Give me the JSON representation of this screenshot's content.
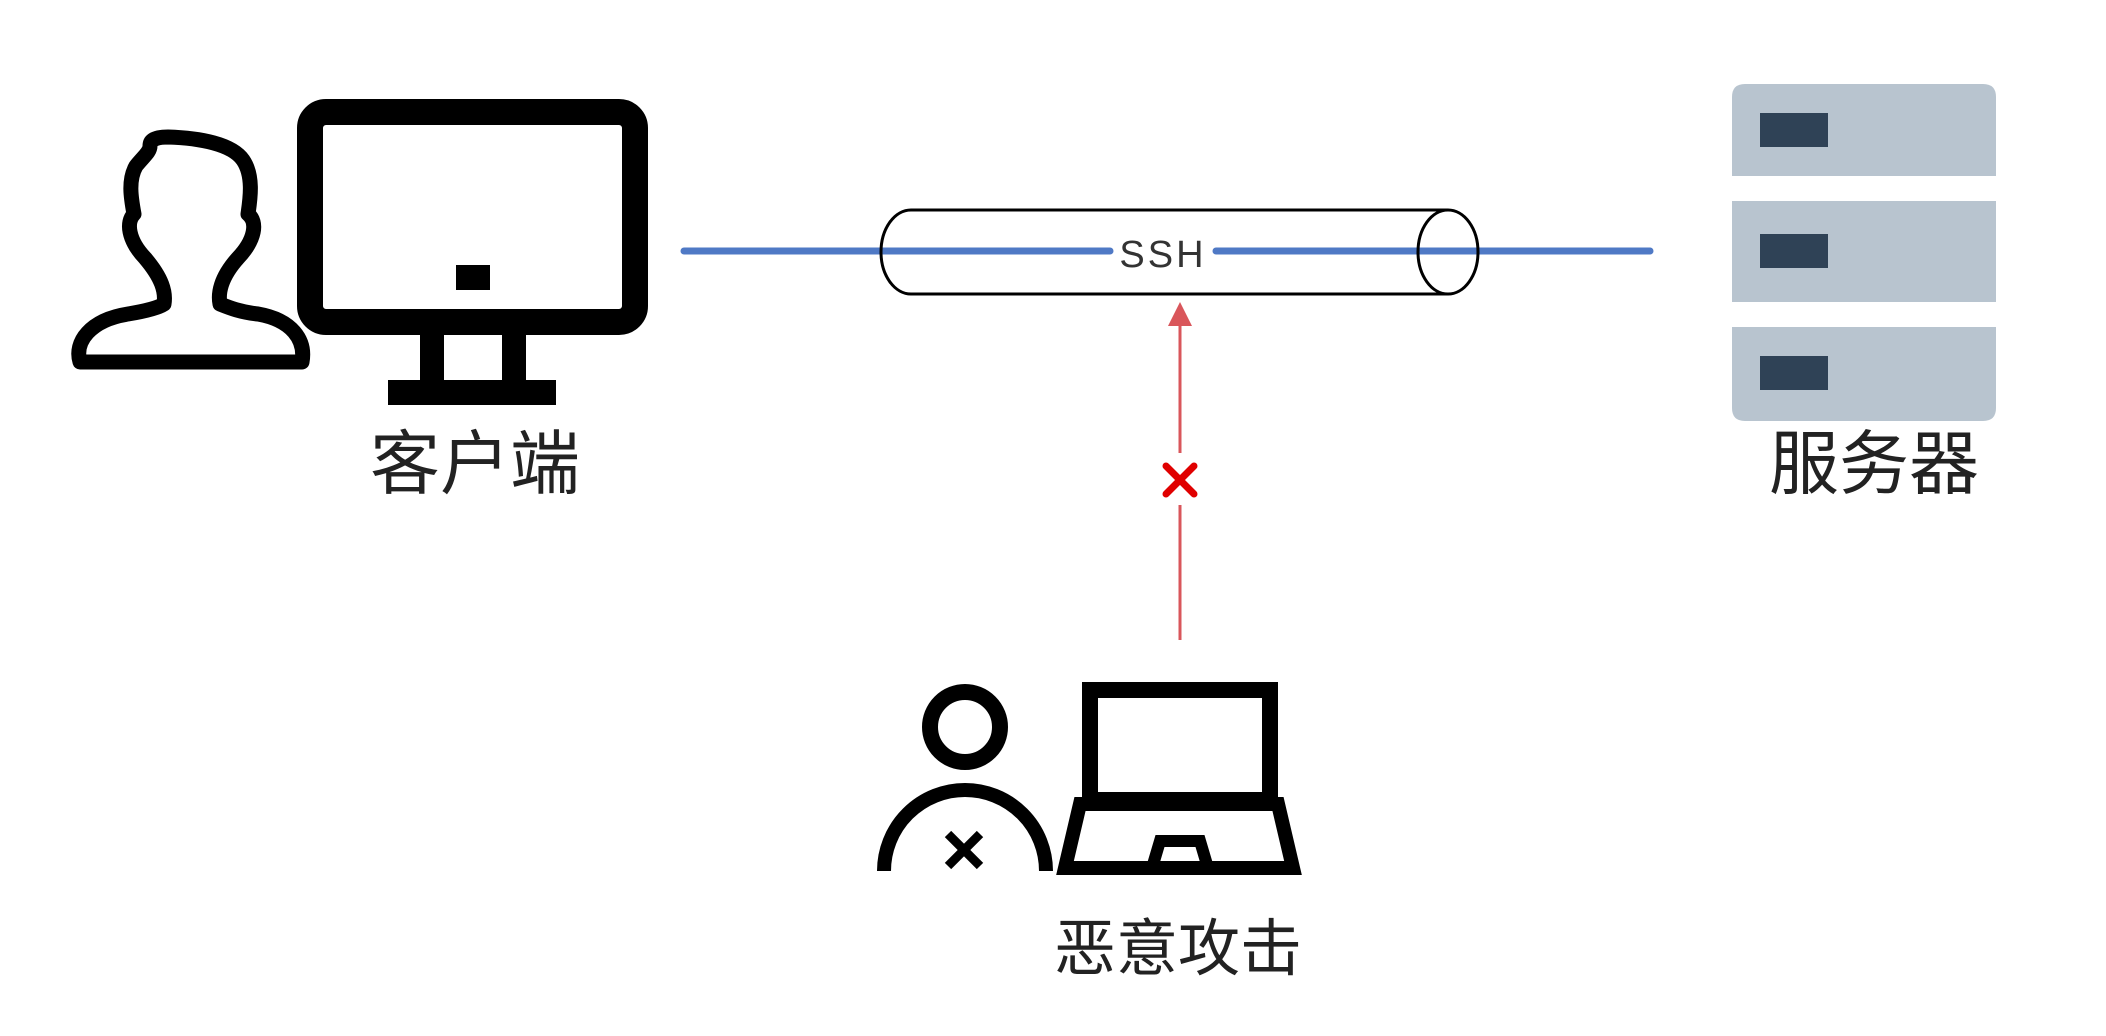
{
  "nodes": {
    "client": {
      "label": "客户端"
    },
    "server": {
      "label": "服务器"
    },
    "attacker": {
      "label": "恶意攻击"
    }
  },
  "tunnel": {
    "label": "SSH"
  },
  "icons": {
    "client_user": "user-icon",
    "client_computer": "desktop-monitor-icon",
    "server": "server-rack-icon",
    "attacker_user": "malicious-user-icon",
    "attacker_computer": "laptop-icon",
    "blocked": "blocked-x-icon"
  },
  "colors": {
    "connection_line": "#4f79c5",
    "attack_arrow": "#d9565b",
    "blocked_mark": "#e00000",
    "server_body": "#b8c4cf",
    "server_slot": "#2f4256",
    "icon_stroke": "#000000"
  }
}
